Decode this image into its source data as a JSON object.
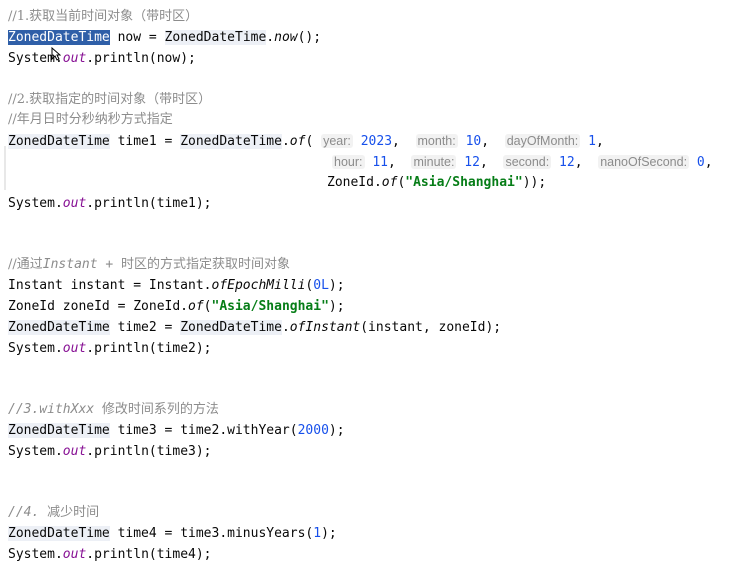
{
  "code": {
    "c1": "//1.获取当前时间对象（带时区）",
    "l1": {
      "cls": "ZonedDateTime",
      "mid": " now = ",
      "cls2": "ZonedDateTime",
      "dot": ".",
      "m": "now",
      "end": "();"
    },
    "l2": {
      "pre": "System.",
      "f": "out",
      "post": ".println(now);"
    },
    "c2": "//2.获取指定的时间对象（带时区）",
    "c3": "//年月日时分秒纳秒方式指定",
    "l3": {
      "cls": "ZonedDateTime",
      "mid": " time1 = ",
      "cls2": "ZonedDateTime",
      "dot": ".",
      "m": "of",
      "open": "( ",
      "h_year": "year:",
      "v_year": "2023",
      "h_month": "month:",
      "v_month": "10",
      "h_day": "dayOfMonth:",
      "v_day": "1"
    },
    "l4": {
      "h_hour": "hour:",
      "v_hour": "11",
      "h_min": "minute:",
      "v_min": "12",
      "h_sec": "second:",
      "v_sec": "12",
      "h_nano": "nanoOfSecond:",
      "v_nano": "0"
    },
    "l5": {
      "pre": "ZoneId.",
      "m": "of",
      "open": "(",
      "s": "\"Asia/Shanghai\"",
      "end": "));"
    },
    "l6": {
      "pre": "System.",
      "f": "out",
      "post": ".println(time1);"
    },
    "c4a": "//通过",
    "c4b": "Instant + ",
    "c4c": "时区的方式指定获取时间对象",
    "l7": {
      "pre": "Instant instant = Instant.",
      "m": "ofEpochMilli",
      "open": "(",
      "n": "0L",
      "end": ");"
    },
    "l8": {
      "pre": "ZoneId zoneId = ZoneId.",
      "m": "of",
      "open": "(",
      "s": "\"Asia/Shanghai\"",
      "end": ");"
    },
    "l9": {
      "cls": "ZonedDateTime",
      "mid": " time2 = ",
      "cls2": "ZonedDateTime",
      "dot": ".",
      "m": "ofInstant",
      "end": "(instant, zoneId);"
    },
    "l10": {
      "pre": "System.",
      "f": "out",
      "post": ".println(time2);"
    },
    "c5a": "//3.withXxx ",
    "c5b": "修改时间系列的方法",
    "l11": {
      "cls": "ZonedDateTime",
      "mid": " time3 = time2.withYear(",
      "n": "2000",
      "end": ");"
    },
    "l12": {
      "pre": "System.",
      "f": "out",
      "post": ".println(time3);"
    },
    "c6a": "//4. ",
    "c6b": "减少时间",
    "l13": {
      "cls": "ZonedDateTime",
      "mid": " time4 = time3.minusYears(",
      "n": "1",
      "end": ");"
    },
    "l14": {
      "pre": "System.",
      "f": "out",
      "post": ".println(time4);"
    }
  }
}
